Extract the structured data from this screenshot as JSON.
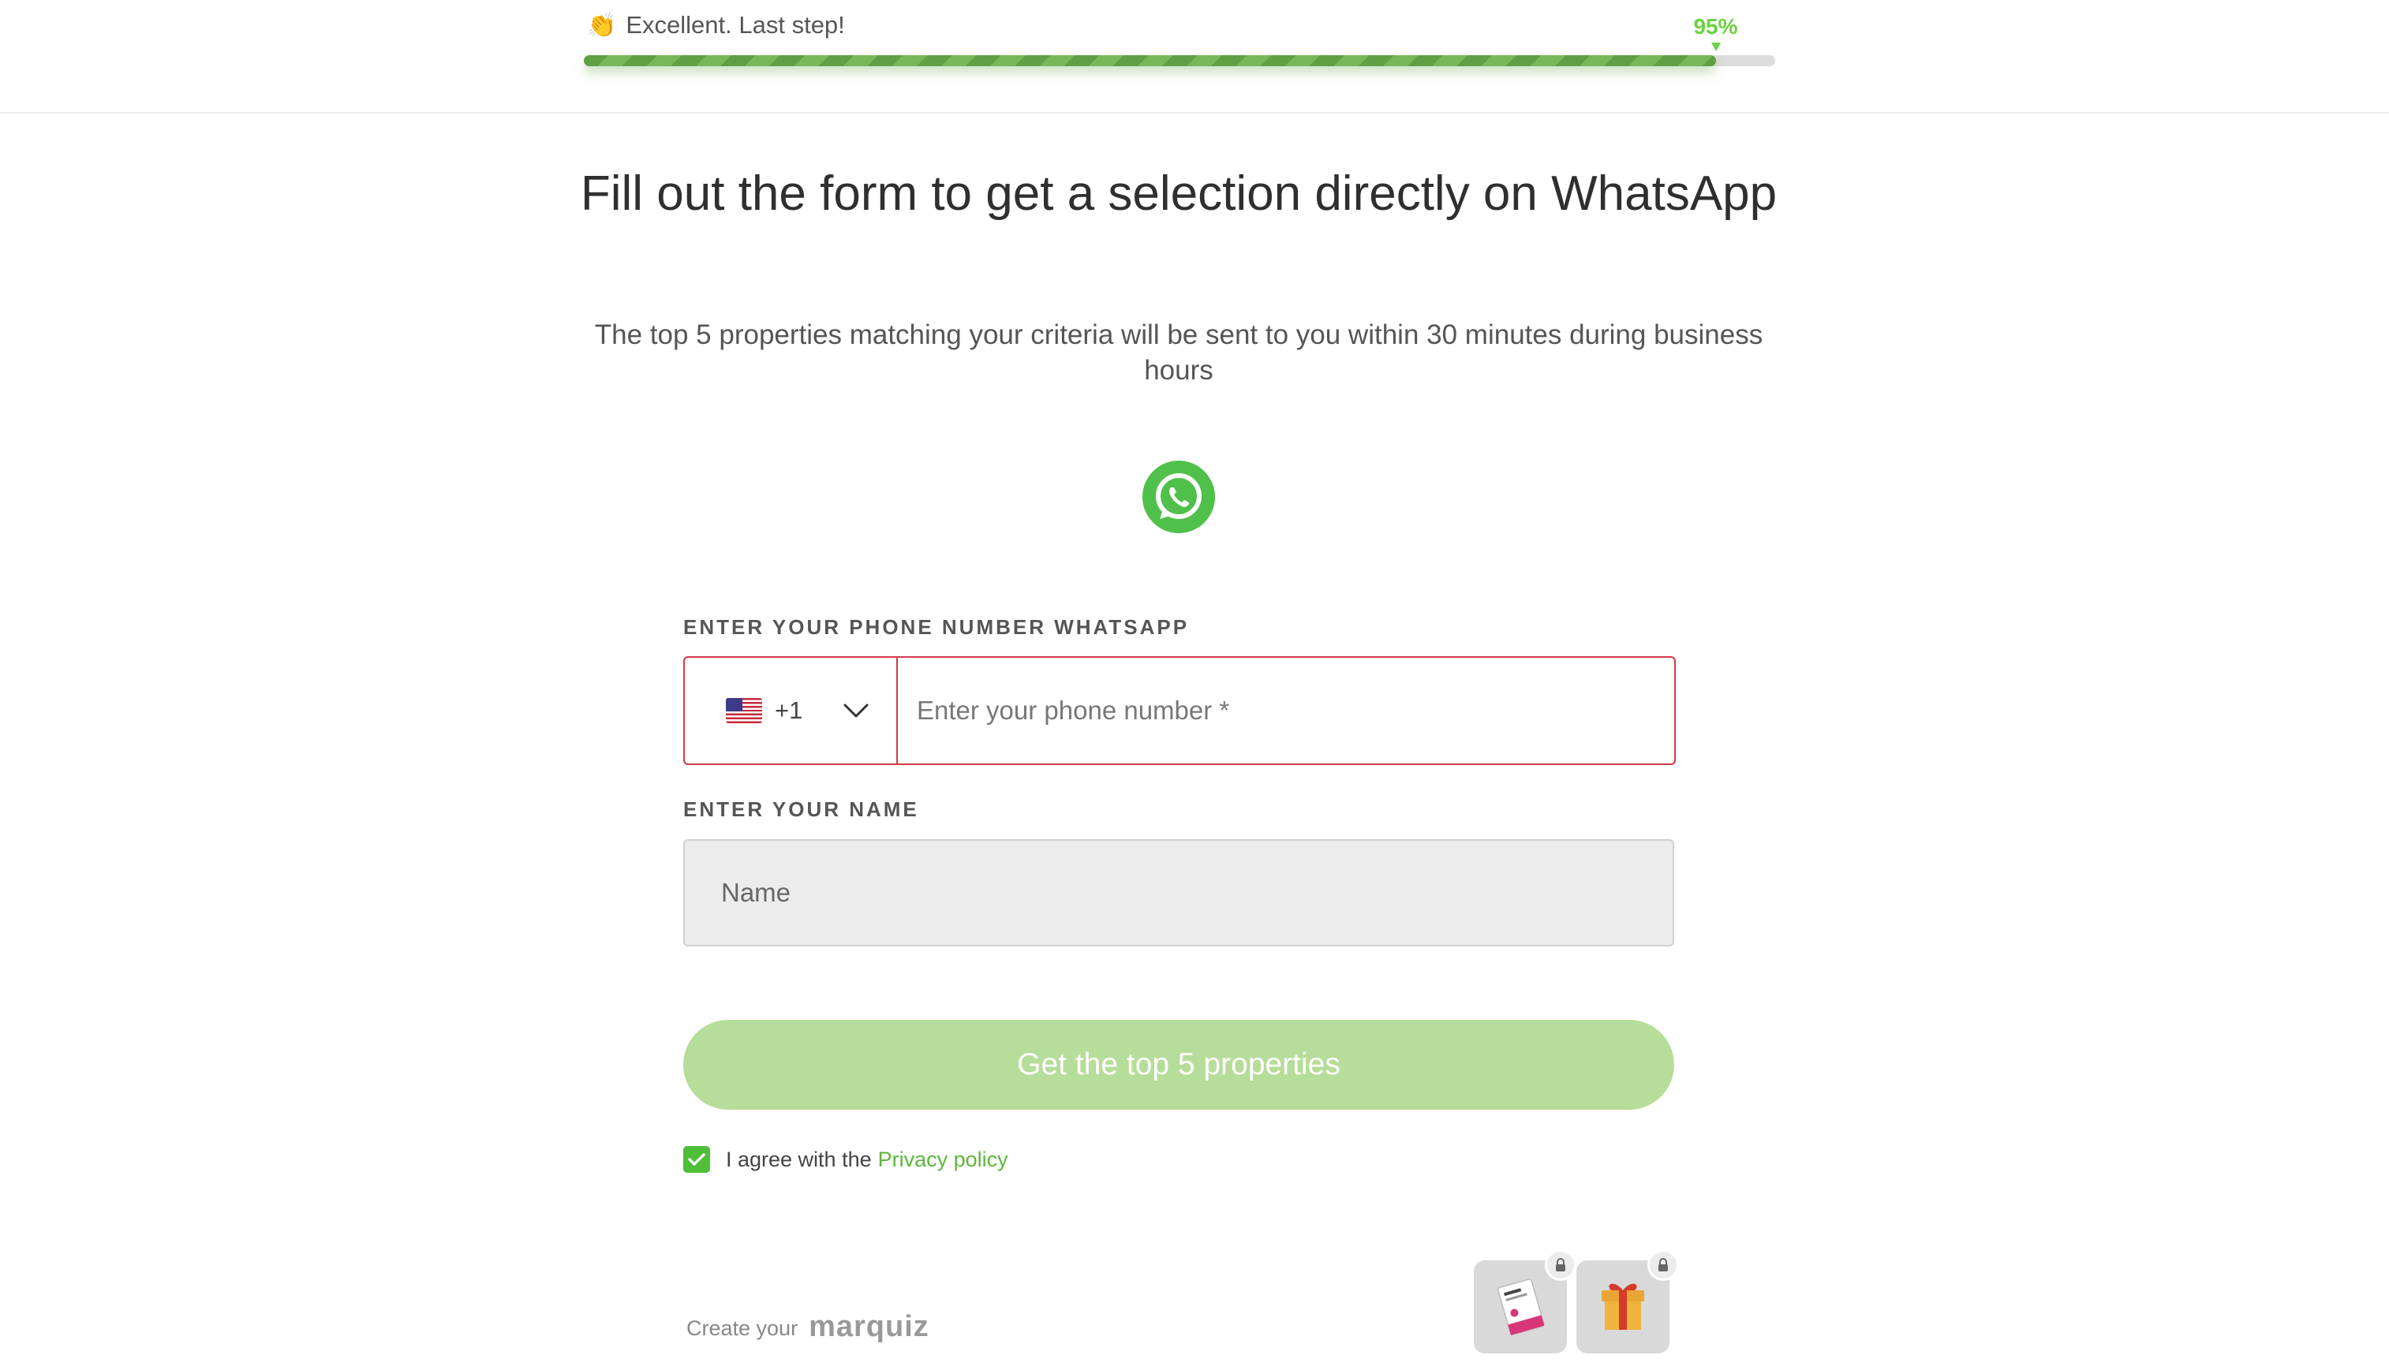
{
  "progress": {
    "emoji": "👏",
    "label": "Excellent. Last step!",
    "percent_text": "95%",
    "value": 0.95
  },
  "heading": {
    "title": "Fill out the form to get a selection directly on WhatsApp",
    "subtitle": "The top 5 properties matching your criteria will be sent to you within 30 minutes during business hours"
  },
  "form": {
    "phone_label": "ENTER YOUR PHONE NUMBER WHATSAPP",
    "country": {
      "flag_icon": "us-flag-icon",
      "dial_code": "+1"
    },
    "phone_placeholder": "Enter your phone number *",
    "phone_value": "",
    "name_label": "ENTER YOUR NAME",
    "name_placeholder": "Name",
    "name_value": "",
    "submit_label": "Get the top 5 properties",
    "agree_text": "I agree with the",
    "privacy_link": "Privacy policy",
    "agree_checked": true
  },
  "footer": {
    "create_text": "Create your",
    "brand": "marquiz",
    "bonuses": [
      {
        "icon": "booklet-icon",
        "locked": true
      },
      {
        "icon": "gift-icon",
        "locked": true
      }
    ]
  },
  "colors": {
    "accent_green": "#6cd23f",
    "whatsapp_green": "#4fc04a",
    "button_green": "#b6dd99",
    "error_red": "#d33a48",
    "link_green": "#5cb83a"
  }
}
